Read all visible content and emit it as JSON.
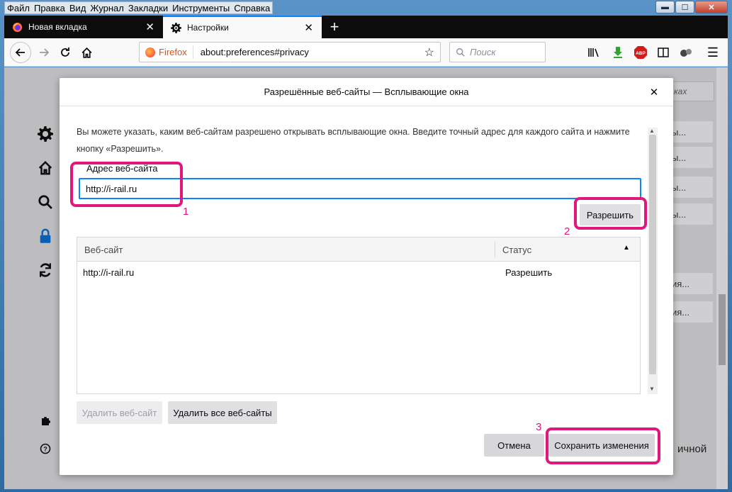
{
  "menu": [
    "Файл",
    "Правка",
    "Вид",
    "Журнал",
    "Закладки",
    "Инструменты",
    "Справка"
  ],
  "window_controls": {
    "minimize": "▬",
    "maximize": "☐",
    "close": "✕"
  },
  "tabs": [
    {
      "label": "Новая вкладка",
      "icon": "firefox-icon"
    },
    {
      "label": "Настройки",
      "icon": "gear-icon"
    }
  ],
  "navbar": {
    "identity": "Firefox",
    "url": "about:preferences#privacy",
    "search_placeholder": "Поиск",
    "abp": "ABP"
  },
  "background_page": {
    "search_hint": "ках",
    "buttons": [
      "ы...",
      "ы...",
      "ы...",
      "ы...",
      "ия...",
      "ия..."
    ],
    "bottom_text": "ичной"
  },
  "dialog": {
    "title": "Разрешённые веб-сайты — Всплывающие окна",
    "description": "Вы можете указать, каким веб-сайтам разрешено открывать всплывающие окна. Введите точный адрес для каждого сайта и нажмите кнопку «Разрешить».",
    "address_label": "Адрес веб-сайта",
    "address_value": "http://i-rail.ru",
    "allow_button": "Разрешить",
    "columns": [
      "Веб-сайт",
      "Статус"
    ],
    "rows": [
      {
        "site": "http://i-rail.ru",
        "status": "Разрешить"
      }
    ],
    "remove_site_button": "Удалить веб-сайт",
    "remove_all_button": "Удалить все веб-сайты",
    "cancel_button": "Отмена",
    "save_button": "Сохранить изменения"
  },
  "annotations": [
    "1",
    "2",
    "3"
  ],
  "colors": {
    "highlight": "#e0177d",
    "focus": "#0a84ff",
    "tab_strip": "#0c0c0d"
  }
}
